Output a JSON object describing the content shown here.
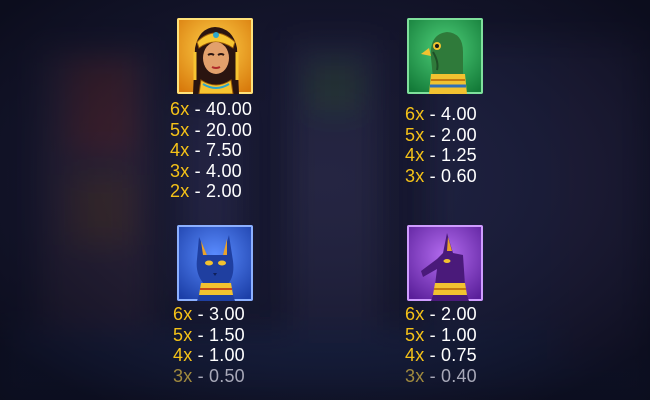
{
  "colors": {
    "multiplier": "#f5c218",
    "value": "#ffffff",
    "dimmed_multiplier": "#a08a3e",
    "dimmed_value": "#a7a8b8",
    "background": "#14162c"
  },
  "symbols": [
    {
      "icon": "cleopatra-icon",
      "tile_color": "#f1a21a",
      "payouts": [
        {
          "mult": "6x",
          "sep": " - ",
          "value": "40.00"
        },
        {
          "mult": "5x",
          "sep": " - ",
          "value": "20.00"
        },
        {
          "mult": "4x",
          "sep": " - ",
          "value": "7.50"
        },
        {
          "mult": "3x",
          "sep": " - ",
          "value": "4.00"
        },
        {
          "mult": "2x",
          "sep": " - ",
          "value": "2.00"
        }
      ]
    },
    {
      "icon": "horus-falcon-icon",
      "tile_color": "#1f9b4d",
      "payouts": [
        {
          "mult": "6x",
          "sep": " - ",
          "value": "4.00"
        },
        {
          "mult": "5x",
          "sep": " - ",
          "value": "2.00"
        },
        {
          "mult": "4x",
          "sep": " - ",
          "value": "1.25"
        },
        {
          "mult": "3x",
          "sep": " - ",
          "value": "0.60"
        }
      ]
    },
    {
      "icon": "bastet-cat-icon",
      "tile_color": "#2f63d9",
      "payouts": [
        {
          "mult": "6x",
          "sep": " - ",
          "value": "3.00"
        },
        {
          "mult": "5x",
          "sep": " - ",
          "value": "1.50"
        },
        {
          "mult": "4x",
          "sep": " - ",
          "value": "1.00"
        },
        {
          "mult": "3x",
          "sep": " - ",
          "value": "0.50"
        }
      ]
    },
    {
      "icon": "anubis-jackal-icon",
      "tile_color": "#8a3fd1",
      "payouts": [
        {
          "mult": "6x",
          "sep": " - ",
          "value": "2.00"
        },
        {
          "mult": "5x",
          "sep": " - ",
          "value": "1.00"
        },
        {
          "mult": "4x",
          "sep": " - ",
          "value": "0.75"
        },
        {
          "mult": "3x",
          "sep": " - ",
          "value": "0.40"
        }
      ]
    }
  ]
}
